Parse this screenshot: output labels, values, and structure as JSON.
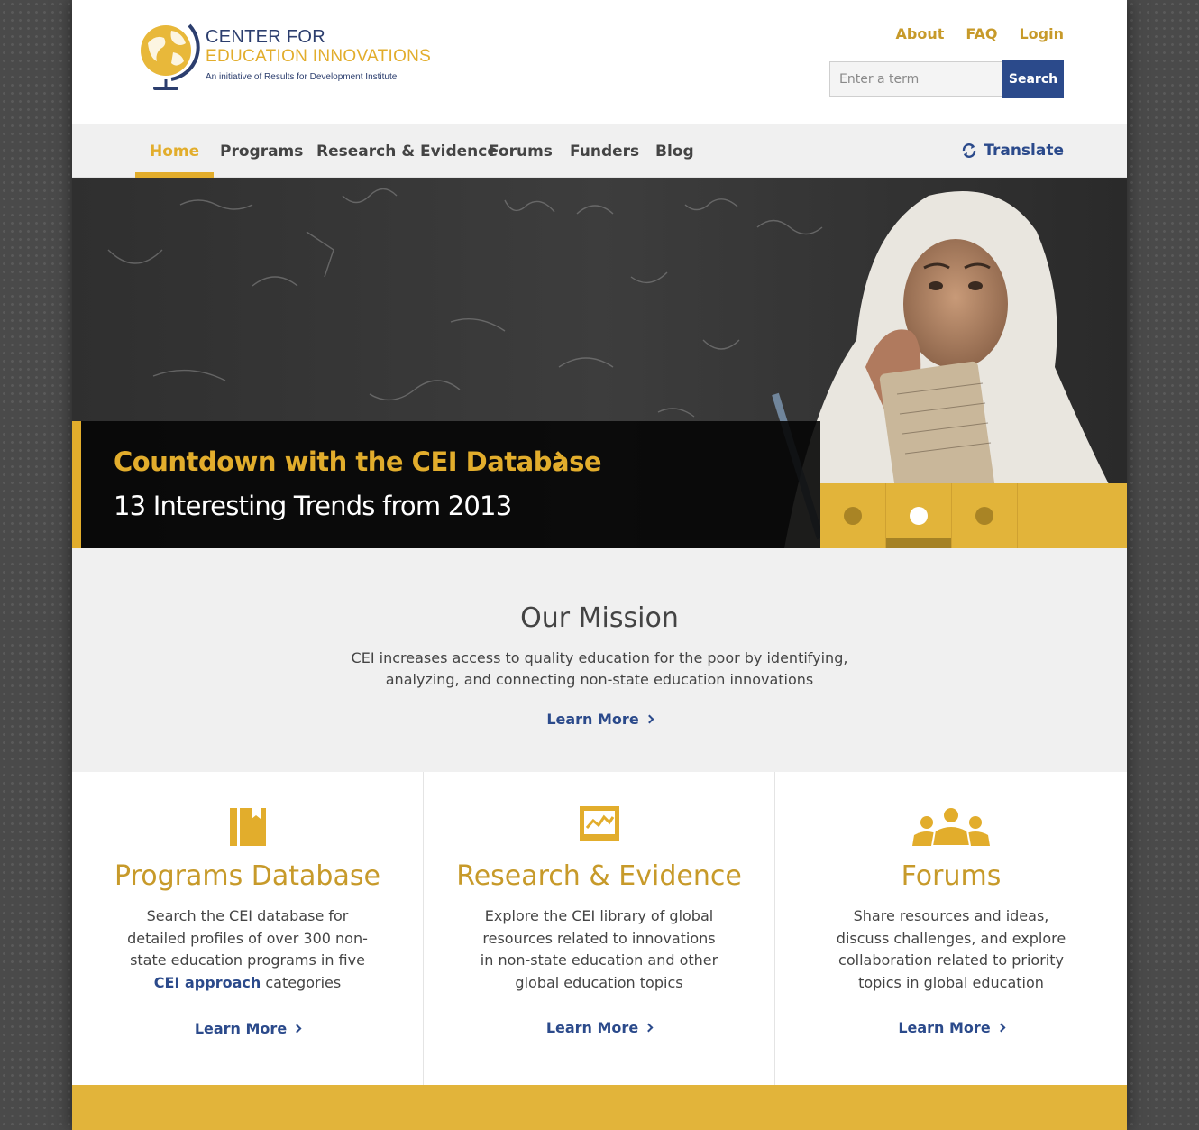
{
  "brand": {
    "line1": "CENTER FOR",
    "line2": "EDUCATION INNOVATIONS",
    "tagline": "An initiative of Results for Development Institute",
    "accent": "#e2ad2c",
    "navy": "#2b4a8b"
  },
  "top_links": {
    "about": "About",
    "faq": "FAQ",
    "login": "Login"
  },
  "search": {
    "placeholder": "Enter a term",
    "button": "Search"
  },
  "nav": {
    "items": [
      {
        "label": "Home",
        "active": true
      },
      {
        "label": "Programs"
      },
      {
        "label": "Research & Evidence"
      },
      {
        "label": "Forums"
      },
      {
        "label": "Funders"
      },
      {
        "label": "Blog"
      }
    ],
    "translate": "Translate"
  },
  "hero": {
    "title": "Countdown with the CEI Database",
    "subtitle": "13 Interesting Trends from 2013",
    "slides": 3,
    "active_slide": 2
  },
  "mission": {
    "title": "Our Mission",
    "text": "CEI increases access to quality education for the poor by identifying, analyzing, and connecting non-state education innovations",
    "learn_more": "Learn More"
  },
  "features": [
    {
      "icon": "book-icon",
      "title": "Programs Database",
      "text_before": "Search the CEI database for detailed profiles of over 300 non-state education programs in five ",
      "link": "CEI approach",
      "text_after": " categories",
      "learn_more": "Learn More"
    },
    {
      "icon": "chart-icon",
      "title": "Research & Evidence",
      "text": "Explore the CEI library of global resources related to innovations in non-state education and other global education topics",
      "learn_more": "Learn More"
    },
    {
      "icon": "people-icon",
      "title": "Forums",
      "text": "Share resources and ideas, discuss challenges, and explore collaboration related to priority topics in global education",
      "learn_more": "Learn More"
    }
  ]
}
